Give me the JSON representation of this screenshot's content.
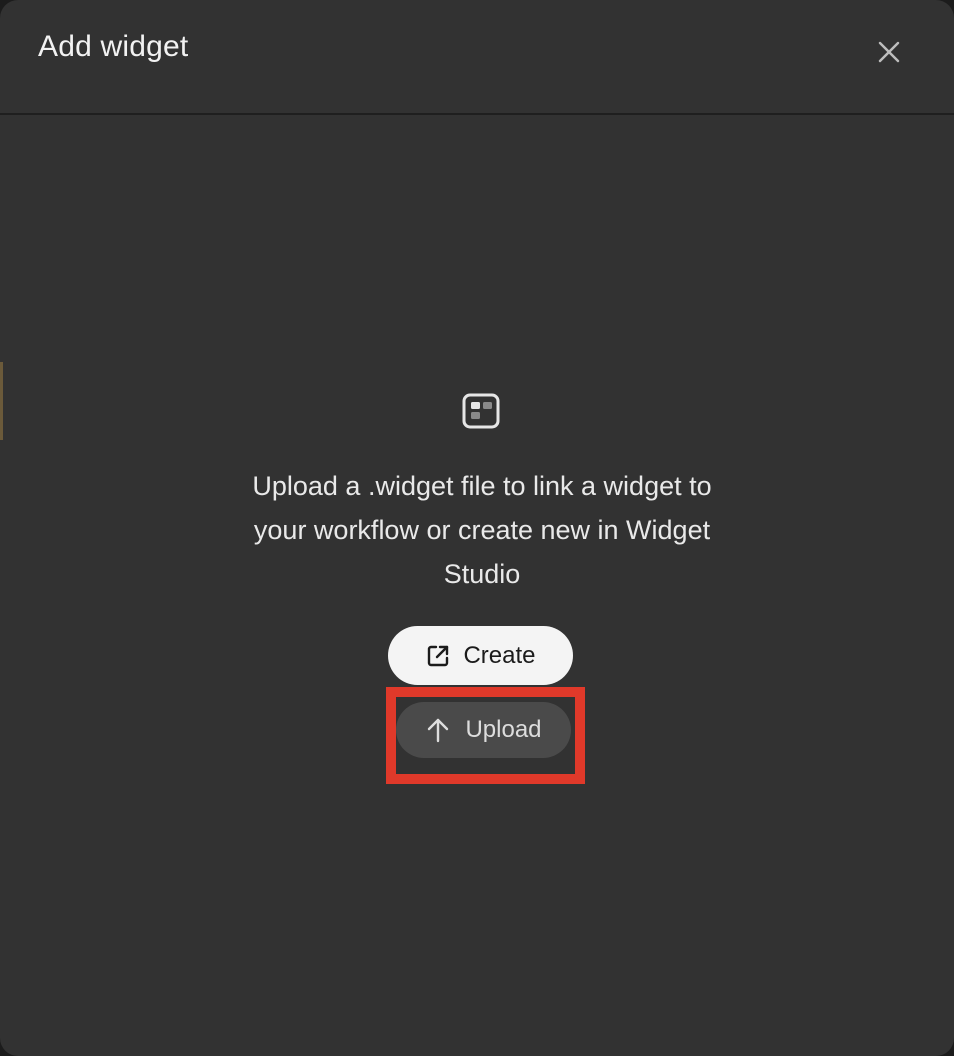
{
  "dialog": {
    "title": "Add widget",
    "close_icon": "close-icon"
  },
  "empty_state": {
    "icon": "widget-icon",
    "message": "Upload a .widget file to link a widget to your workflow or create new in Widget Studio"
  },
  "actions": {
    "create": {
      "label": "Create",
      "icon": "external-link-icon"
    },
    "upload": {
      "label": "Upload",
      "icon": "arrow-up-icon"
    }
  },
  "colors": {
    "dialog_bg": "#323232",
    "create_bg": "#f4f4f4",
    "upload_bg": "#4a4a4a",
    "highlight": "#e0392a"
  }
}
